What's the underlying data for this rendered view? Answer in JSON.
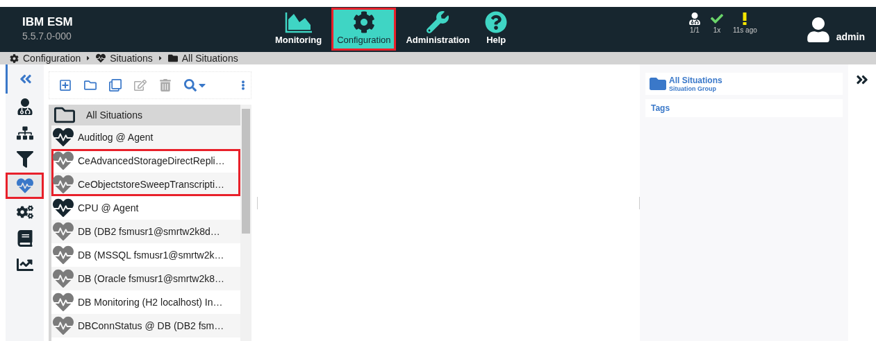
{
  "app": {
    "title": "IBM ESM",
    "version": "5.5.7.0-000"
  },
  "nav": [
    {
      "kind": "monitoring",
      "label": "Monitoring",
      "selected": false,
      "highlighted": false
    },
    {
      "kind": "configuration",
      "label": "Configuration",
      "selected": true,
      "highlighted": true
    },
    {
      "kind": "administration",
      "label": "Administration",
      "selected": false,
      "highlighted": false
    },
    {
      "kind": "help",
      "label": "Help",
      "selected": false,
      "highlighted": false
    }
  ],
  "status": [
    {
      "kind": "agents",
      "text": "1/1"
    },
    {
      "kind": "ok",
      "text": "1x"
    },
    {
      "kind": "warning",
      "text": "11s ago"
    }
  ],
  "user": {
    "name": "admin"
  },
  "breadcrumb": [
    {
      "kind": "gear",
      "label": "Configuration"
    },
    {
      "kind": "heart",
      "label": "Situations"
    },
    {
      "kind": "folder",
      "label": "All Situations"
    }
  ],
  "rail": [
    {
      "kind": "agents",
      "selected": false,
      "highlighted": false
    },
    {
      "kind": "hierarchy",
      "selected": false,
      "highlighted": false
    },
    {
      "kind": "filter",
      "selected": false,
      "highlighted": false
    },
    {
      "kind": "situations",
      "selected": true,
      "highlighted": true
    },
    {
      "kind": "settings",
      "selected": false,
      "highlighted": false
    },
    {
      "kind": "book",
      "selected": false,
      "highlighted": false
    },
    {
      "kind": "chart",
      "selected": false,
      "highlighted": false
    }
  ],
  "toolbar": [
    {
      "kind": "add",
      "disabled": false
    },
    {
      "kind": "folder",
      "disabled": false
    },
    {
      "kind": "copy",
      "disabled": false
    },
    {
      "kind": "edit",
      "disabled": true
    },
    {
      "kind": "delete",
      "disabled": true
    },
    {
      "kind": "search",
      "disabled": false
    },
    {
      "kind": "more",
      "disabled": false
    }
  ],
  "tree": {
    "root": "All Situations",
    "items": [
      {
        "label": "Auditlog @ Agent",
        "active": true,
        "highlighted": false
      },
      {
        "label": "CeAdvancedStorageDirectRepli…",
        "active": false,
        "highlighted": true
      },
      {
        "label": "CeObjectstoreSweepTranscripti…",
        "active": false,
        "highlighted": true
      },
      {
        "label": "CPU @ Agent",
        "active": true,
        "highlighted": false
      },
      {
        "label": "DB (DB2 fsmusr1@smrtw2k8d…",
        "active": false,
        "highlighted": false
      },
      {
        "label": "DB (MSSQL fsmusr1@smrtw2k…",
        "active": false,
        "highlighted": false
      },
      {
        "label": "DB (Oracle fsmusr1@smrtw2k8…",
        "active": false,
        "highlighted": false
      },
      {
        "label": "DB Monitoring (H2 localhost) In…",
        "active": false,
        "highlighted": false
      },
      {
        "label": "DBConnStatus @ DB (DB2 fsm…",
        "active": false,
        "highlighted": false
      }
    ]
  },
  "details": {
    "title": "All Situations",
    "subtitle": "Situation Group",
    "tags_label": "Tags"
  }
}
